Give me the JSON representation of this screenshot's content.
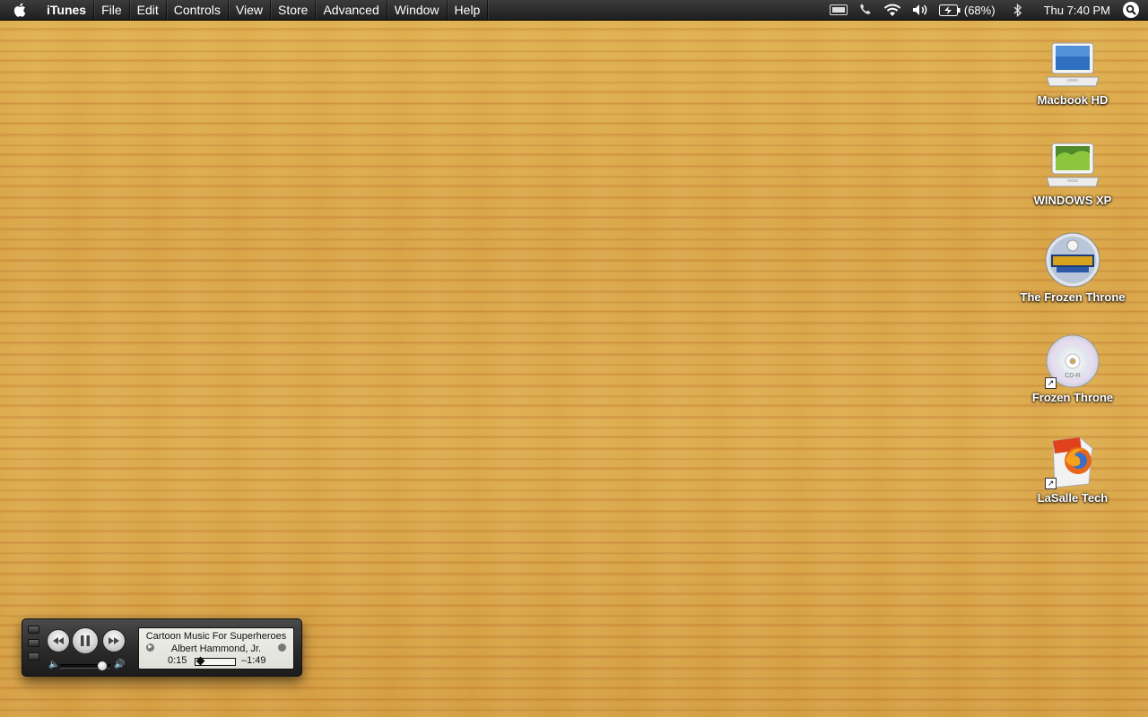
{
  "menubar": {
    "app_name": "iTunes",
    "menus": [
      "File",
      "Edit",
      "Controls",
      "View",
      "Store",
      "Advanced",
      "Window",
      "Help"
    ],
    "battery_text": "(68%)",
    "clock": "Thu 7:40 PM"
  },
  "desktop_icons": [
    {
      "label": "Macbook HD",
      "icon": "laptop-drive-icon"
    },
    {
      "label": "WINDOWS XP",
      "icon": "laptop-drive-icon"
    },
    {
      "label": "The Frozen Throne",
      "icon": "warcraft-disc-icon"
    },
    {
      "label": "Frozen Throne",
      "icon": "cdr-disc-icon",
      "alias": true
    },
    {
      "label": "LaSalle Tech",
      "icon": "firefox-document-icon",
      "alias": true
    }
  ],
  "miniplayer": {
    "song": "Cartoon Music For Superheroes",
    "artist": "Albert Hammond, Jr.",
    "elapsed": "0:15",
    "remaining": "–1:49",
    "progress_fraction": 0.12,
    "volume_fraction": 0.82,
    "cdr_text": "CD-R"
  },
  "colors": {
    "menubar": "#262626",
    "wood": "#d9a448"
  }
}
